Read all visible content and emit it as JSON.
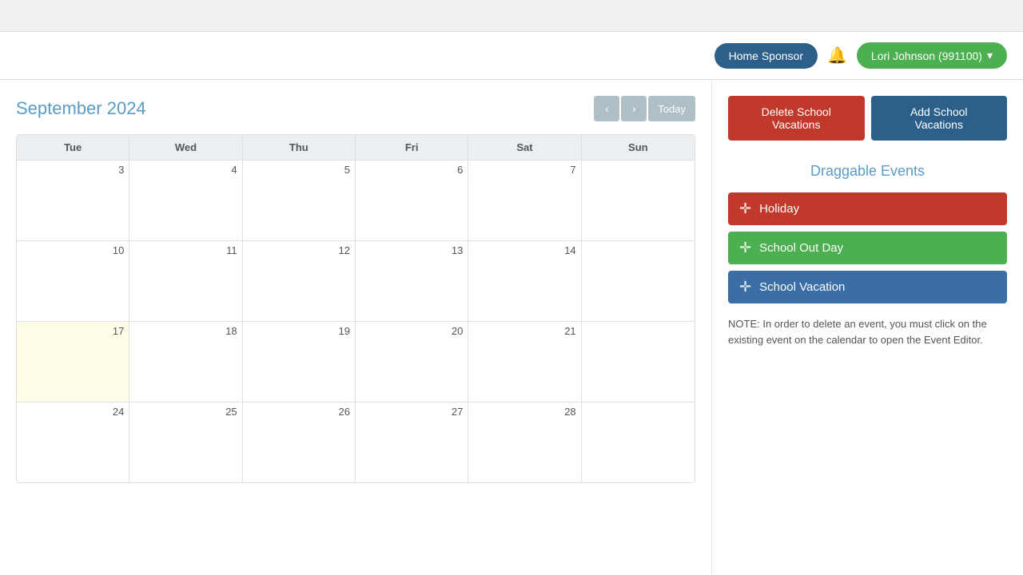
{
  "header": {
    "home_sponsor_label": "Home Sponsor",
    "bell_icon": "🔔",
    "user_label": "Lori Johnson (991100)",
    "user_chevron": "▾"
  },
  "toolbar": {
    "delete_label": "Delete School Vacations",
    "add_label": "Add School Vacations"
  },
  "calendar": {
    "title": "September 2024",
    "prev_label": "‹",
    "next_label": "›",
    "today_label": "Today",
    "days": [
      "Tue",
      "Wed",
      "Thu",
      "Fri",
      "Sat",
      "Sun"
    ],
    "weeks": [
      [
        {
          "num": "3",
          "today": false
        },
        {
          "num": "4",
          "today": false
        },
        {
          "num": "5",
          "today": false
        },
        {
          "num": "6",
          "today": false
        },
        {
          "num": "7",
          "today": false
        },
        {
          "num": "",
          "today": false
        }
      ],
      [
        {
          "num": "10",
          "today": false
        },
        {
          "num": "11",
          "today": false
        },
        {
          "num": "12",
          "today": false
        },
        {
          "num": "13",
          "today": false
        },
        {
          "num": "14",
          "today": false
        },
        {
          "num": "",
          "today": false
        }
      ],
      [
        {
          "num": "17",
          "today": true
        },
        {
          "num": "18",
          "today": false
        },
        {
          "num": "19",
          "today": false
        },
        {
          "num": "20",
          "today": false
        },
        {
          "num": "21",
          "today": false
        },
        {
          "num": "",
          "today": false
        }
      ],
      [
        {
          "num": "24",
          "today": false
        },
        {
          "num": "25",
          "today": false
        },
        {
          "num": "26",
          "today": false
        },
        {
          "num": "27",
          "today": false
        },
        {
          "num": "28",
          "today": false
        },
        {
          "num": "",
          "today": false
        }
      ]
    ]
  },
  "sidebar": {
    "draggable_title": "Draggable Events",
    "events": [
      {
        "label": "Holiday",
        "type": "holiday",
        "icon": "✛"
      },
      {
        "label": "School Out Day",
        "type": "school-out",
        "icon": "✛"
      },
      {
        "label": "School Vacation",
        "type": "school-vacation",
        "icon": "✛"
      }
    ],
    "note": "NOTE: In order to delete an event, you must click on the existing event on the calendar to open the Event Editor."
  }
}
